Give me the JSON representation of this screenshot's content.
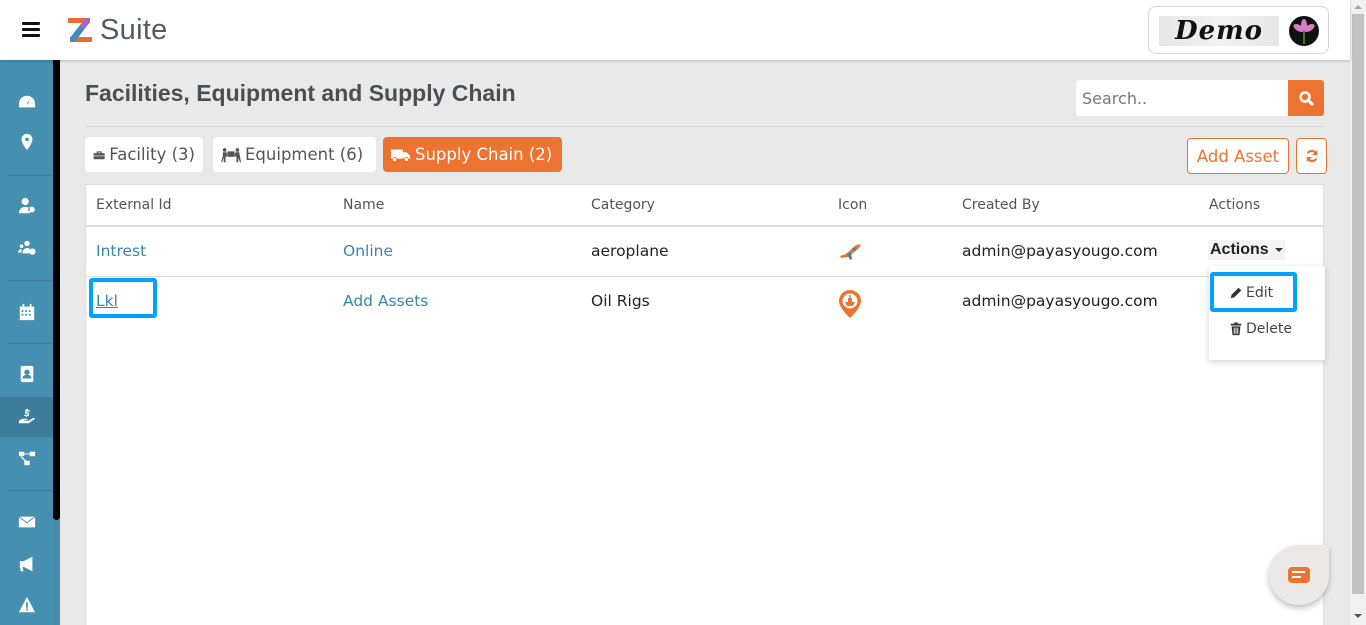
{
  "header": {
    "app_name": "Suite",
    "demo_label": "Demo"
  },
  "sidebar": {
    "items": [
      {
        "name": "dashboard",
        "icon": "tachometer-icon",
        "active": false
      },
      {
        "name": "locations",
        "icon": "map-marker-icon",
        "active": false
      },
      {
        "name": "user-tags",
        "icon": "user-tag-icon",
        "active": false
      },
      {
        "name": "user-groups",
        "icon": "users-cog-icon",
        "active": false
      },
      {
        "name": "calendar",
        "icon": "calendar-icon",
        "active": false
      },
      {
        "name": "contacts",
        "icon": "address-book-icon",
        "active": false
      },
      {
        "name": "assets",
        "icon": "hand-holding-usd-icon",
        "active": true
      },
      {
        "name": "workflow",
        "icon": "project-diagram-icon",
        "active": false
      },
      {
        "name": "messages",
        "icon": "envelope-icon",
        "active": false
      },
      {
        "name": "campaigns",
        "icon": "bullhorn-icon",
        "active": false
      },
      {
        "name": "alerts",
        "icon": "warning-icon",
        "active": false
      }
    ]
  },
  "page": {
    "title": "Facilities, Equipment and Supply Chain",
    "search_placeholder": "Search..",
    "search_value": ""
  },
  "tabs": [
    {
      "label": "Facility (3)",
      "icon": "toolbox-icon",
      "active": false
    },
    {
      "label": "Equipment (6)",
      "icon": "people-carry-icon",
      "active": false
    },
    {
      "label": "Supply Chain (2)",
      "icon": "truck-icon",
      "active": true
    }
  ],
  "toolbar": {
    "add_asset_label": "Add Asset",
    "refresh_icon": "refresh-icon"
  },
  "table": {
    "columns": [
      "External Id",
      "Name",
      "Category",
      "Icon",
      "Created By",
      "Actions"
    ],
    "rows": [
      {
        "external_id": "Intrest",
        "name": "Online",
        "category": "aeroplane",
        "icon": "airplane-icon",
        "created_by": "admin@payasyougo.com",
        "actions": "Actions"
      },
      {
        "external_id": "Lkl",
        "name": "Add Assets",
        "category": "Oil Rigs",
        "icon": "ship-pin-icon",
        "created_by": "admin@payasyougo.com",
        "actions": ""
      }
    ]
  },
  "actions_menu": {
    "items": [
      {
        "label": "Edit",
        "icon": "pencil-icon"
      },
      {
        "label": "Delete",
        "icon": "trash-icon"
      }
    ]
  },
  "colors": {
    "accent": "#ed7430",
    "sidebar": "#458fb0",
    "link": "#3a86a8",
    "highlight": "#00a2ff"
  }
}
